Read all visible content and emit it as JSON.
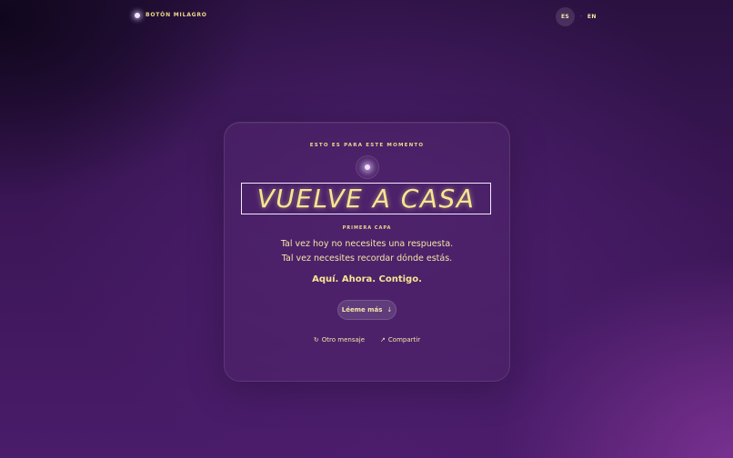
{
  "brand": {
    "label": "BOTÓN MILAGRO",
    "dot_icon": "glow-dot-icon"
  },
  "language": {
    "options": [
      "ES",
      "EN"
    ],
    "selected": "ES",
    "separator": "·"
  },
  "card": {
    "eyebrow": "ESTO ES PARA ESTE MOMENTO",
    "orb_icon": "glow-orb-icon",
    "title": "VUELVE A CASA",
    "layer_label": "PRIMERA CAPA",
    "lines": [
      "Tal vez hoy no necesites una respuesta.",
      "Tal vez necesites recordar dónde estás."
    ],
    "emphasis": "Aquí. Ahora. Contigo.",
    "read_more": {
      "label": "Léeme más",
      "icon": "arrow-down-icon",
      "glyph": "↓"
    },
    "actions": [
      {
        "label": "Otro mensaje",
        "icon": "refresh-icon",
        "glyph": "↻"
      },
      {
        "label": "Compartir",
        "icon": "share-arrow-icon",
        "glyph": "↗"
      }
    ]
  },
  "colors": {
    "accent_text": "#f6e690",
    "background": "#3b1656",
    "card": "#4e246a"
  }
}
